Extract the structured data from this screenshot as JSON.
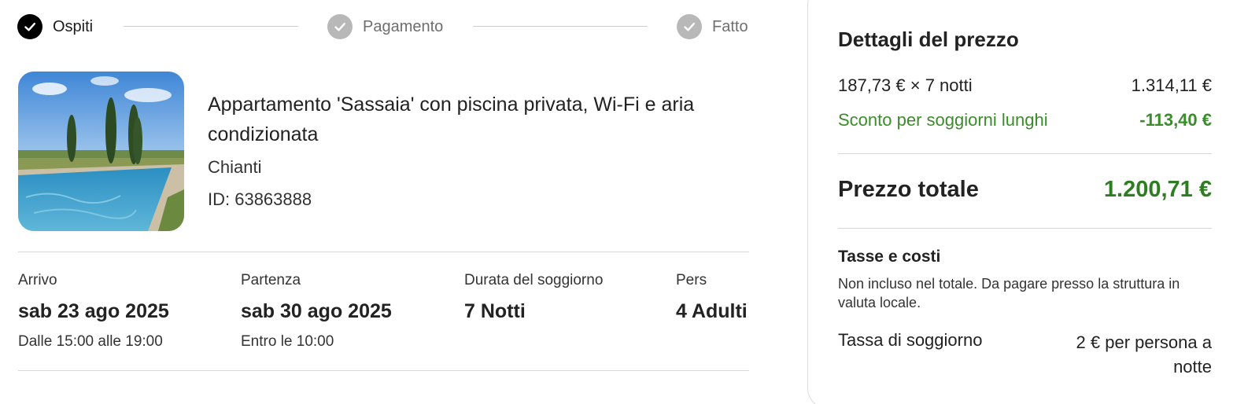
{
  "stepper": {
    "steps": [
      {
        "label": "Ospiti",
        "state": "active",
        "icon": "check-icon"
      },
      {
        "label": "Pagamento",
        "state": "done",
        "icon": "check-icon"
      },
      {
        "label": "Fatto",
        "state": "done",
        "icon": "check-icon"
      }
    ]
  },
  "property": {
    "title": "Appartamento 'Sassaia' con piscina privata, Wi-Fi e aria condizionata",
    "location": "Chianti",
    "id": "ID: 63863888"
  },
  "stay": {
    "checkin": {
      "label": "Arrivo",
      "value": "sab 23 ago 2025",
      "sub": "Dalle 15:00 alle 19:00"
    },
    "checkout": {
      "label": "Partenza",
      "value": "sab 30 ago 2025",
      "sub": "Entro le 10:00"
    },
    "duration": {
      "label": "Durata del soggiorno",
      "value": "7 Notti"
    },
    "guests": {
      "label": "Pers",
      "value": "4 Adulti"
    }
  },
  "price": {
    "title": "Dettagli del prezzo",
    "base_label": "187,73 € × 7 notti",
    "base_amount": "1.314,11 €",
    "discount_label": "Sconto per soggiorni lunghi",
    "discount_amount": "-113,40 €",
    "total_label": "Prezzo totale",
    "total_amount": "1.200,71 €",
    "taxes_title": "Tasse e costi",
    "taxes_note": "Non incluso nel totale. Da pagare presso la struttura in valuta locale.",
    "city_tax_label": "Tassa di soggiorno",
    "city_tax_amount": "2 € per persona a notte"
  },
  "colors": {
    "discount_green": "#3b8c2a",
    "total_green": "#2e7d22",
    "active_step": "#000000",
    "done_step": "#b8b8b8"
  }
}
